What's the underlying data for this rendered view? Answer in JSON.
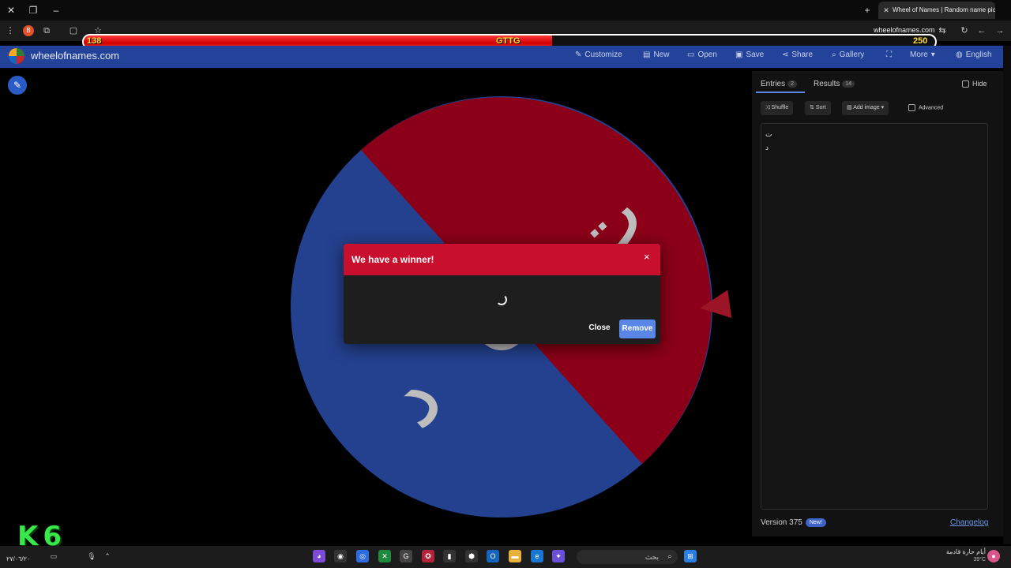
{
  "browser": {
    "tab_title": "Wheel of Names | Random name picker",
    "url": "wheelofnames.com"
  },
  "stream_bar": {
    "left_value": "138",
    "center_label": "GTTG",
    "right_value": "250",
    "progress": 0.55
  },
  "site": {
    "brand": "wheelofnames.com",
    "nav": {
      "customize": "Customize",
      "new": "New",
      "open": "Open",
      "save": "Save",
      "share": "Share",
      "gallery": "Gallery",
      "more": "More",
      "language": "English"
    }
  },
  "wheel": {
    "segments": [
      {
        "label": "ت",
        "color": "#8b0018"
      },
      {
        "label": "د",
        "color": "#24418f"
      }
    ],
    "pointer_color": "#9c1526"
  },
  "dialog": {
    "title": "We have a winner!",
    "close_x": "×",
    "close_button": "Close",
    "remove_button": "Remove"
  },
  "panel": {
    "tabs": {
      "entries_label": "Entries",
      "entries_count": "2",
      "results_label": "Results",
      "results_count": "14"
    },
    "hide_label": "Hide",
    "tools": {
      "shuffle": "Shuffle",
      "sort": "Sort",
      "add_image": "Add image",
      "advanced": "Advanced"
    },
    "entries": [
      "ت",
      "د"
    ],
    "version": "Version 375",
    "new_badge": "New!",
    "changelog": "Changelog"
  },
  "overlay": {
    "k6": "K6"
  },
  "taskbar": {
    "search_text": "بحث",
    "time": "أيام حارة قادمة",
    "temp": "39°C",
    "date": "٢٧/٠٦/٢٠",
    "colors": {
      "bg": "#1c1c1c"
    }
  }
}
